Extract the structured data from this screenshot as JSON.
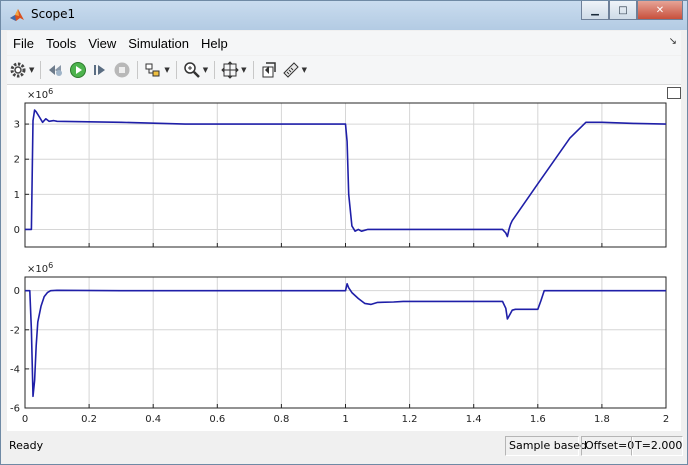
{
  "window": {
    "title": "Scope1"
  },
  "menu": {
    "items": [
      "File",
      "Tools",
      "View",
      "Simulation",
      "Help"
    ]
  },
  "toolbar": {
    "buttons": [
      "settings-icon",
      "rewind-icon",
      "run-icon",
      "step-forward-icon",
      "stop-icon",
      "highlight-block-icon",
      "zoom-icon",
      "fit-view-icon",
      "restore-axes-icon",
      "measurements-icon"
    ]
  },
  "status": {
    "ready": "Ready",
    "sample_mode": "Sample based",
    "offset": "Offset=0",
    "time": "T=2.000"
  },
  "chart_data": [
    {
      "type": "line",
      "exponent_label": "×10",
      "exponent_power": "6",
      "xlim": [
        0,
        2
      ],
      "ylim": [
        -0.5,
        3.6
      ],
      "yticks": [
        0,
        1,
        2,
        3
      ],
      "xtick_labels_shown": false,
      "grid": true,
      "series": [
        {
          "color": "#1f1fa8",
          "x": [
            0,
            0.02,
            0.025,
            0.03,
            0.035,
            0.045,
            0.055,
            0.065,
            0.075,
            0.09,
            0.1,
            0.3,
            0.5,
            0.7,
            0.9,
            1.0,
            1.005,
            1.01,
            1.02,
            1.03,
            1.04,
            1.05,
            1.07,
            1.1,
            1.15,
            1.2,
            1.3,
            1.4,
            1.49,
            1.5,
            1.505,
            1.51,
            1.515,
            1.52,
            1.6,
            1.7,
            1.75,
            1.8,
            1.9,
            2.0
          ],
          "y": [
            0,
            0,
            3.1,
            3.4,
            3.35,
            3.2,
            3.05,
            3.15,
            3.08,
            3.1,
            3.08,
            3.05,
            3.0,
            3.0,
            3.0,
            3.0,
            2.5,
            1.0,
            0.1,
            -0.05,
            0.0,
            -0.05,
            0.0,
            0.0,
            0.0,
            0.0,
            0.0,
            0.0,
            0.0,
            -0.1,
            -0.2,
            0.0,
            0.15,
            0.25,
            1.3,
            2.6,
            3.05,
            3.05,
            3.02,
            3.0
          ]
        }
      ]
    },
    {
      "type": "line",
      "exponent_label": "×10",
      "exponent_power": "6",
      "xlim": [
        0,
        2
      ],
      "ylim": [
        -6,
        0.7
      ],
      "yticks": [
        -6,
        -4,
        -2,
        0
      ],
      "xticks": [
        0,
        0.2,
        0.4,
        0.6,
        0.8,
        1,
        1.2,
        1.4,
        1.6,
        1.8,
        2
      ],
      "grid": true,
      "series": [
        {
          "color": "#1f1fa8",
          "x": [
            0,
            0.015,
            0.02,
            0.025,
            0.03,
            0.035,
            0.04,
            0.05,
            0.06,
            0.07,
            0.08,
            0.1,
            0.3,
            0.6,
            0.9,
            1.0,
            1.005,
            1.01,
            1.02,
            1.04,
            1.06,
            1.08,
            1.1,
            1.15,
            1.18,
            1.2,
            1.3,
            1.49,
            1.5,
            1.505,
            1.51,
            1.52,
            1.53,
            1.6,
            1.61,
            1.62,
            1.7,
            1.8,
            2.0
          ],
          "y": [
            0,
            0,
            -2.0,
            -5.4,
            -4.6,
            -2.8,
            -1.6,
            -0.8,
            -0.3,
            -0.1,
            0.0,
            0.02,
            0.0,
            0.0,
            0.0,
            0.0,
            0.35,
            0.15,
            -0.1,
            -0.4,
            -0.65,
            -0.7,
            -0.6,
            -0.58,
            -0.55,
            -0.55,
            -0.55,
            -0.55,
            -0.9,
            -1.45,
            -1.3,
            -1.0,
            -0.95,
            -0.95,
            -0.5,
            0.0,
            0.0,
            0.0,
            0.0
          ]
        }
      ]
    }
  ]
}
